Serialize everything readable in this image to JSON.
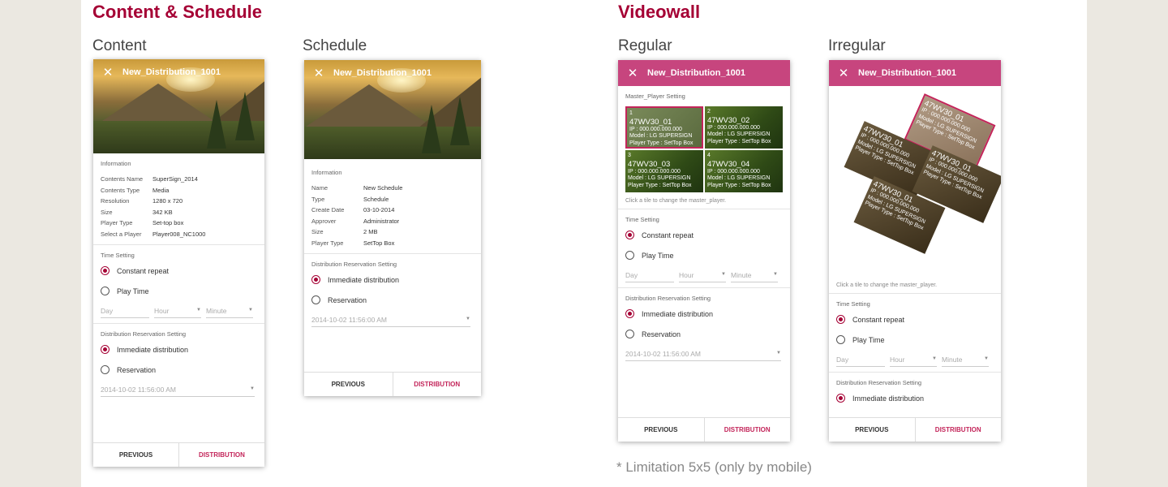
{
  "sections": {
    "left_title": "Content & Schedule",
    "right_title": "Videowall"
  },
  "subtitles": {
    "content": "Content",
    "schedule": "Schedule",
    "regular": "Regular",
    "irregular": "Irregular"
  },
  "note": "* Limitation 5x5 (only by mobile)",
  "common": {
    "close_icon": "✕",
    "dist_title": "New_Distribution_1001",
    "information": "Information",
    "time_setting": "Time Setting",
    "constant_repeat": "Constant repeat",
    "play_time": "Play Time",
    "day": "Day",
    "hour": "Hour",
    "minute": "Minute",
    "dist_res_setting": "Distribution Reservation Setting",
    "immediate": "Immediate distribution",
    "reservation": "Reservation",
    "datetime": "2014-10-02 11:56:00 AM",
    "previous": "PREVIOUS",
    "distribution": "DISTRIBUTION",
    "master_setting": "Master_Player Setting",
    "hint": "Click a tile to change the master_player."
  },
  "content_info": [
    {
      "k": "Contents Name",
      "v": "SuperSign_2014"
    },
    {
      "k": "Contents Type",
      "v": "Media"
    },
    {
      "k": "Resolution",
      "v": "1280 x 720"
    },
    {
      "k": "Size",
      "v": "342 KB"
    },
    {
      "k": "Player Type",
      "v": "Set-top box"
    },
    {
      "k": "Select a Player",
      "v": "Player008_NC1000"
    }
  ],
  "schedule_info": [
    {
      "k": "Name",
      "v": "New Schedule"
    },
    {
      "k": "Type",
      "v": "Schedule"
    },
    {
      "k": "Create Date",
      "v": "03-10-2014"
    },
    {
      "k": "Approver",
      "v": "Administrator"
    },
    {
      "k": "Size",
      "v": "2 MB"
    },
    {
      "k": "Player Type",
      "v": "SetTop Box"
    }
  ],
  "tiles": [
    {
      "num": "1",
      "name": "47WV30_01",
      "ip": "IP : 000.000.000.000",
      "model": "Model : LG SUPERSIGN",
      "ptype": "Player Type : SetTop Box"
    },
    {
      "num": "2",
      "name": "47WV30_02",
      "ip": "IP : 000.000.000.000",
      "model": "Model : LG SUPERSIGN",
      "ptype": "Player Type : SetTop Box"
    },
    {
      "num": "3",
      "name": "47WV30_03",
      "ip": "IP : 000.000.000.000",
      "model": "Model : LG SUPERSIGN",
      "ptype": "Player Type : SetTop Box"
    },
    {
      "num": "4",
      "name": "47WV30_04",
      "ip": "IP : 000.000.000.000",
      "model": "Model : LG SUPERSIGN",
      "ptype": "Player Type : SetTop Box"
    }
  ],
  "irr_tiles": [
    {
      "name": "47WV30_01",
      "ip": "IP : 000.000.000.000",
      "model": "Model : LG SUPERSIGN",
      "ptype": "Player Type : SetTop Box"
    },
    {
      "name": "47WV30_01",
      "ip": "IP : 000.000.000.000",
      "model": "Model : LG SUPERSIGN",
      "ptype": "Player Type : SetTop Box"
    },
    {
      "name": "47WV30_01",
      "ip": "IP : 000.000.000.000",
      "model": "Model : LG SUPERSIGN",
      "ptype": "Player Type : SetTop Box"
    },
    {
      "name": "47WV30_01",
      "ip": "IP : 000.000.000.000",
      "model": "Model : LG SUPERSIGN",
      "ptype": "Player Type : SetTop Box"
    }
  ],
  "colors": {
    "accent": "#a50034",
    "pink_bar": "#c7457e",
    "dist_button": "#c3255a"
  }
}
